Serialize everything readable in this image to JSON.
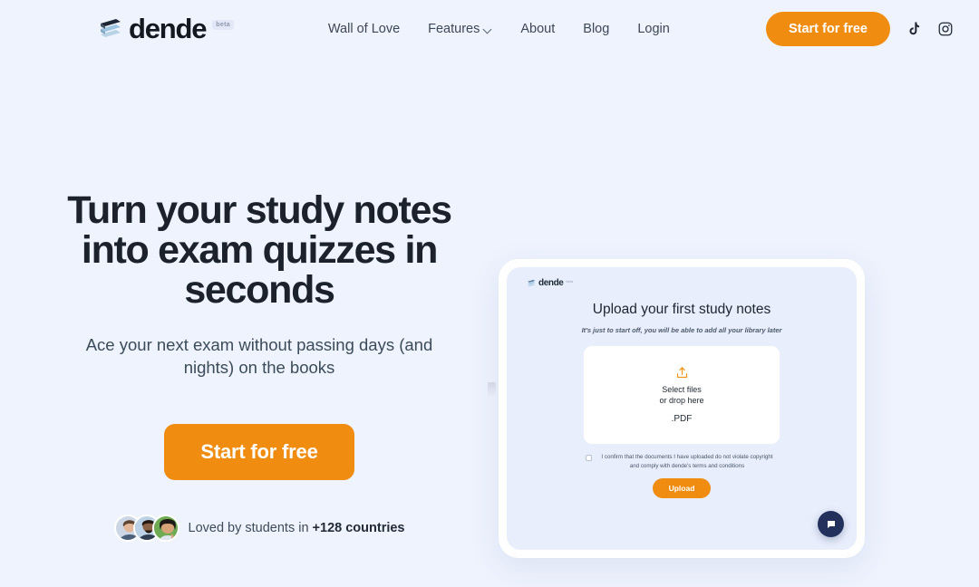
{
  "header": {
    "brand": {
      "name": "dende",
      "badge": "beta",
      "mark_icon": "dende-stack-logo-icon"
    },
    "nav": [
      {
        "label": "Wall of Love",
        "icon": null
      },
      {
        "label": "Features",
        "icon": "chevron-down-icon"
      },
      {
        "label": "About",
        "icon": null
      },
      {
        "label": "Blog",
        "icon": null
      },
      {
        "label": "Login",
        "icon": null
      }
    ],
    "cta_label": "Start for free",
    "social": [
      {
        "name": "tiktok-icon",
        "label": "TikTok"
      },
      {
        "name": "instagram-icon",
        "label": "Instagram"
      }
    ]
  },
  "hero": {
    "headline": "Turn your study notes into exam quizzes in seconds",
    "subhead": "Ace your next exam without passing days (and nights) on the books",
    "cta_label": "Start for free",
    "social_proof": {
      "prefix": "Loved by students in ",
      "highlight": "+128 countries",
      "avatar_count": 3
    }
  },
  "mockup": {
    "logo": {
      "name": "dende",
      "badge": "beta"
    },
    "title": "Upload your first study notes",
    "subtitle": "It's just to start off, you will be able to add all your library later",
    "dropzone": {
      "icon": "upload-icon",
      "line1": "Select files",
      "line2": "or drop here",
      "filetype": ".PDF"
    },
    "consent": {
      "checked": false,
      "text": "I confirm that the documents I have uploaded do not violate copyright and comply with dende's terms and conditions"
    },
    "upload_button": "Upload",
    "chat_widget": {
      "icon": "chat-bubble-icon"
    }
  },
  "colors": {
    "page_background": "#eef3fe",
    "accent_orange": "#f08c10",
    "text_dark": "#1b222c",
    "text_muted": "#3c4b5a",
    "mock_panel": "#e8eefc",
    "chat_navy": "#23305c"
  }
}
